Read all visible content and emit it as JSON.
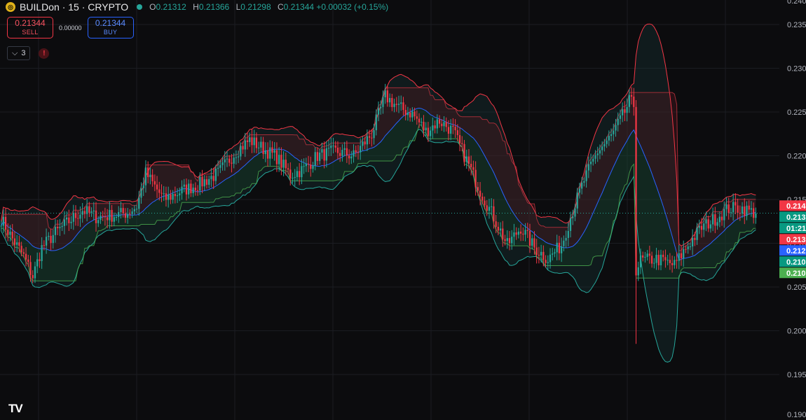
{
  "header": {
    "symbol": "BUILDon",
    "interval": "15",
    "exchange": "CRYPTO",
    "symbol_title": "BUILDon · 15 · CRYPTO",
    "coin_icon": "builddon-coin-icon",
    "open_label": "O",
    "open": "0.21312",
    "high_label": "H",
    "high": "0.21366",
    "low_label": "L",
    "low": "0.21298",
    "close_label": "C",
    "close": "0.21344",
    "change": "+0.00032 (+0.15%)"
  },
  "trade": {
    "sell_price": "0.21344",
    "sell_label": "SELL",
    "spread": "0.00000",
    "buy_price": "0.21344",
    "buy_label": "BUY"
  },
  "indicators": {
    "toggle_icon": "chevron-down-icon",
    "count": "3",
    "alert_icon": "!"
  },
  "logo_text": "TV",
  "colors": {
    "background": "#0c0c0e",
    "up": "#26a69a",
    "down": "#f23645",
    "basis": "#2962ff",
    "upper_band": "#f23645",
    "lower_band": "#26a69a",
    "grid": "#1b1d22",
    "text": "#d1d4dc"
  },
  "chart_data": {
    "type": "candlestick",
    "ylim": [
      0.1898,
      0.2378
    ],
    "y_ticks": [
      "0.195",
      "0.200",
      "0.205",
      "0.210",
      "0.215",
      "0.220",
      "0.225",
      "0.230",
      "0.235"
    ],
    "y_tick_values": [
      0.195,
      0.2,
      0.205,
      0.21,
      0.215,
      0.22,
      0.225,
      0.23,
      0.235
    ],
    "top_partial_tick": "0.240",
    "bottom_partial_tick": "0.190",
    "grid": true,
    "close_waypoints": [
      [
        0,
        0.2128
      ],
      [
        5,
        0.2105
      ],
      [
        10,
        0.2085
      ],
      [
        14,
        0.2062
      ],
      [
        18,
        0.2095
      ],
      [
        24,
        0.2112
      ],
      [
        30,
        0.2125
      ],
      [
        36,
        0.2138
      ],
      [
        42,
        0.213
      ],
      [
        50,
        0.2132
      ],
      [
        56,
        0.2135
      ],
      [
        60,
        0.2142
      ],
      [
        64,
        0.218
      ],
      [
        68,
        0.2165
      ],
      [
        72,
        0.215
      ],
      [
        80,
        0.216
      ],
      [
        88,
        0.2168
      ],
      [
        96,
        0.218
      ],
      [
        104,
        0.2205
      ],
      [
        110,
        0.2218
      ],
      [
        116,
        0.2208
      ],
      [
        122,
        0.2198
      ],
      [
        128,
        0.2178
      ],
      [
        134,
        0.2185
      ],
      [
        140,
        0.22
      ],
      [
        148,
        0.2205
      ],
      [
        156,
        0.22
      ],
      [
        164,
        0.2225
      ],
      [
        170,
        0.2268
      ],
      [
        176,
        0.2255
      ],
      [
        182,
        0.2248
      ],
      [
        188,
        0.2228
      ],
      [
        194,
        0.224
      ],
      [
        200,
        0.2228
      ],
      [
        206,
        0.2195
      ],
      [
        212,
        0.216
      ],
      [
        218,
        0.213
      ],
      [
        224,
        0.2098
      ],
      [
        230,
        0.2118
      ],
      [
        236,
        0.2095
      ],
      [
        242,
        0.2082
      ],
      [
        248,
        0.2098
      ],
      [
        252,
        0.213
      ],
      [
        258,
        0.2172
      ],
      [
        264,
        0.2205
      ],
      [
        270,
        0.2222
      ],
      [
        276,
        0.225
      ],
      [
        278,
        0.2262
      ],
      [
        280,
        0.2258
      ],
      [
        281,
        0.207
      ],
      [
        283,
        0.208
      ],
      [
        290,
        0.2082
      ],
      [
        298,
        0.2075
      ],
      [
        304,
        0.2098
      ],
      [
        310,
        0.2118
      ],
      [
        316,
        0.2128
      ],
      [
        322,
        0.214
      ],
      [
        328,
        0.214
      ],
      [
        334,
        0.2134
      ]
    ],
    "last_price": "0.21344",
    "price_labels": [
      {
        "text": "0.214",
        "value": 0.2143,
        "color": "#f23645"
      },
      {
        "text": "0.213",
        "value": 0.2134,
        "color": "#089981"
      },
      {
        "text": "01:21",
        "value": 0.2129,
        "color": "#089981"
      },
      {
        "text": "0.213",
        "value": 0.213,
        "color": "#f23645"
      },
      {
        "text": "0.212",
        "value": 0.2122,
        "color": "#2962ff"
      },
      {
        "text": "0.210",
        "value": 0.2112,
        "color": "#089981"
      },
      {
        "text": "0.210",
        "value": 0.2104,
        "color": "#4caf50"
      }
    ]
  }
}
